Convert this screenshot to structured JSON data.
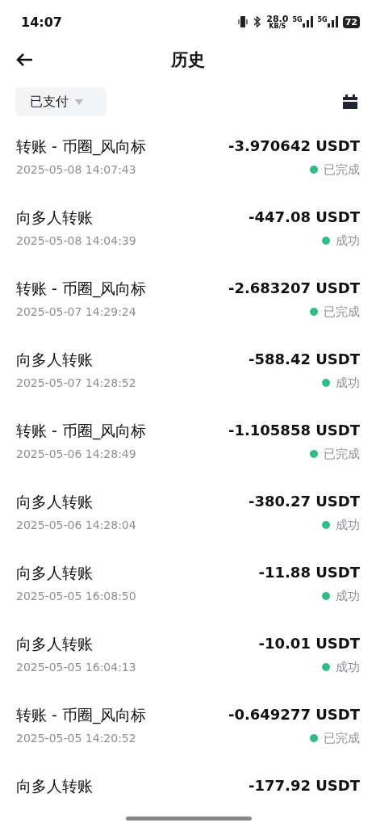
{
  "status_bar": {
    "time": "14:07",
    "speed": "28.0",
    "speed_unit": "KB/S",
    "network_1": "5G",
    "network_2": "5G",
    "battery": "72"
  },
  "header": {
    "title": "历史"
  },
  "filter": {
    "label": "已支付"
  },
  "transactions": [
    {
      "title": "转账 - 币圈_风向标",
      "date": "2025-05-08 14:07:43",
      "amount": "-3.970642 USDT",
      "status": "已完成"
    },
    {
      "title": "向多人转账",
      "date": "2025-05-08 14:04:39",
      "amount": "-447.08 USDT",
      "status": "成功"
    },
    {
      "title": "转账 - 币圈_风向标",
      "date": "2025-05-07 14:29:24",
      "amount": "-2.683207 USDT",
      "status": "已完成"
    },
    {
      "title": "向多人转账",
      "date": "2025-05-07 14:28:52",
      "amount": "-588.42 USDT",
      "status": "成功"
    },
    {
      "title": "转账 - 币圈_风向标",
      "date": "2025-05-06 14:28:49",
      "amount": "-1.105858 USDT",
      "status": "已完成"
    },
    {
      "title": "向多人转账",
      "date": "2025-05-06 14:28:04",
      "amount": "-380.27 USDT",
      "status": "成功"
    },
    {
      "title": "向多人转账",
      "date": "2025-05-05 16:08:50",
      "amount": "-11.88 USDT",
      "status": "成功"
    },
    {
      "title": "向多人转账",
      "date": "2025-05-05 16:04:13",
      "amount": "-10.01 USDT",
      "status": "成功"
    },
    {
      "title": "转账 - 币圈_风向标",
      "date": "2025-05-05 14:20:52",
      "amount": "-0.649277 USDT",
      "status": "已完成"
    },
    {
      "title": "向多人转账",
      "amount": "-177.92 USDT"
    }
  ]
}
